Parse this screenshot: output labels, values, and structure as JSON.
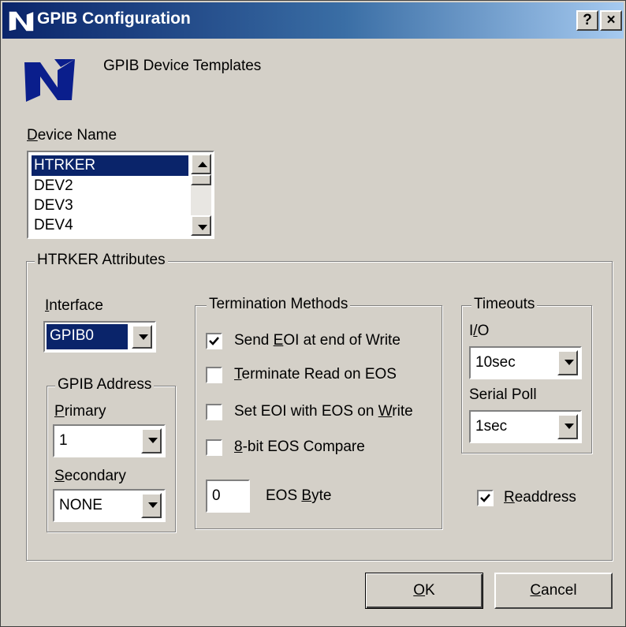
{
  "window": {
    "title": "GPIB Configuration",
    "help_label": "?",
    "close_label": "×"
  },
  "header": {
    "text": "GPIB Device Templates"
  },
  "device_name": {
    "label_prefix": "D",
    "label_rest": "evice Name",
    "items": [
      "HTRKER",
      "DEV2",
      "DEV3",
      "DEV4"
    ],
    "selected": "HTRKER"
  },
  "attributes": {
    "title": "HTRKER Attributes",
    "interface": {
      "label_prefix": "I",
      "label_rest": "nterface",
      "value": "GPIB0"
    },
    "gpib_address": {
      "title": "GPIB Address",
      "primary": {
        "label_prefix": "P",
        "label_rest": "rimary",
        "value": "1"
      },
      "secondary": {
        "label_prefix": "S",
        "label_rest": "econdary",
        "value": "NONE"
      }
    },
    "termination": {
      "title": "Termination Methods",
      "options": [
        {
          "pre": "Send ",
          "key": "E",
          "post": "OI at end of Write",
          "checked": true
        },
        {
          "pre": "",
          "key": "T",
          "post": "erminate Read on EOS",
          "checked": false
        },
        {
          "pre": "Set EOI with EOS on ",
          "key": "W",
          "post": "rite",
          "checked": false
        },
        {
          "pre": "",
          "key": "8",
          "post": "-bit EOS Compare",
          "checked": false
        }
      ],
      "eos_value": "0",
      "eos_label_pre": "EOS ",
      "eos_label_key": "B",
      "eos_label_post": "yte"
    },
    "timeouts": {
      "title": "Timeouts",
      "io": {
        "label_pre": "I",
        "label_key": "/",
        "label_post": "O",
        "value": "10sec"
      },
      "serial_poll": {
        "label": "Serial Poll",
        "value": "1sec"
      }
    },
    "readdress": {
      "key": "R",
      "rest": "eaddress",
      "checked": true
    }
  },
  "buttons": {
    "ok_key": "O",
    "ok_rest": "K",
    "cancel_key": "C",
    "cancel_rest": "ancel"
  }
}
